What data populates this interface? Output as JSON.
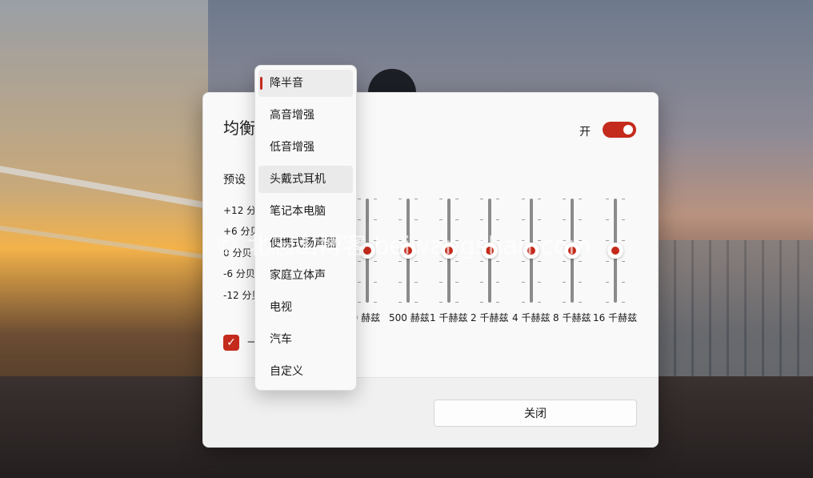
{
  "dialog": {
    "title": "均衡",
    "toggle_label": "开",
    "preset_label": "预设",
    "db_labels": [
      "+12 分贝",
      "+6 分贝",
      "0 分贝",
      "-6 分贝",
      "-12 分贝"
    ],
    "freq_labels": [
      "60 赫兹",
      "500 赫兹",
      "1 千赫兹",
      "2 千赫兹",
      "4 千赫兹",
      "8 千赫兹",
      "16 千赫兹"
    ],
    "checkbox_label": "—",
    "close_label": "关闭"
  },
  "dropdown": {
    "selected": "降半音",
    "items": [
      "降半音",
      "高音增强",
      "低音增强",
      "头戴式耳机",
      "笔记本电脑",
      "便携式扬声器",
      "家庭立体声",
      "电视",
      "汽车",
      "自定义"
    ]
  },
  "watermark": "© 北忘山博客 beiwangshan.com",
  "colors": {
    "accent": "#c42b1c"
  }
}
